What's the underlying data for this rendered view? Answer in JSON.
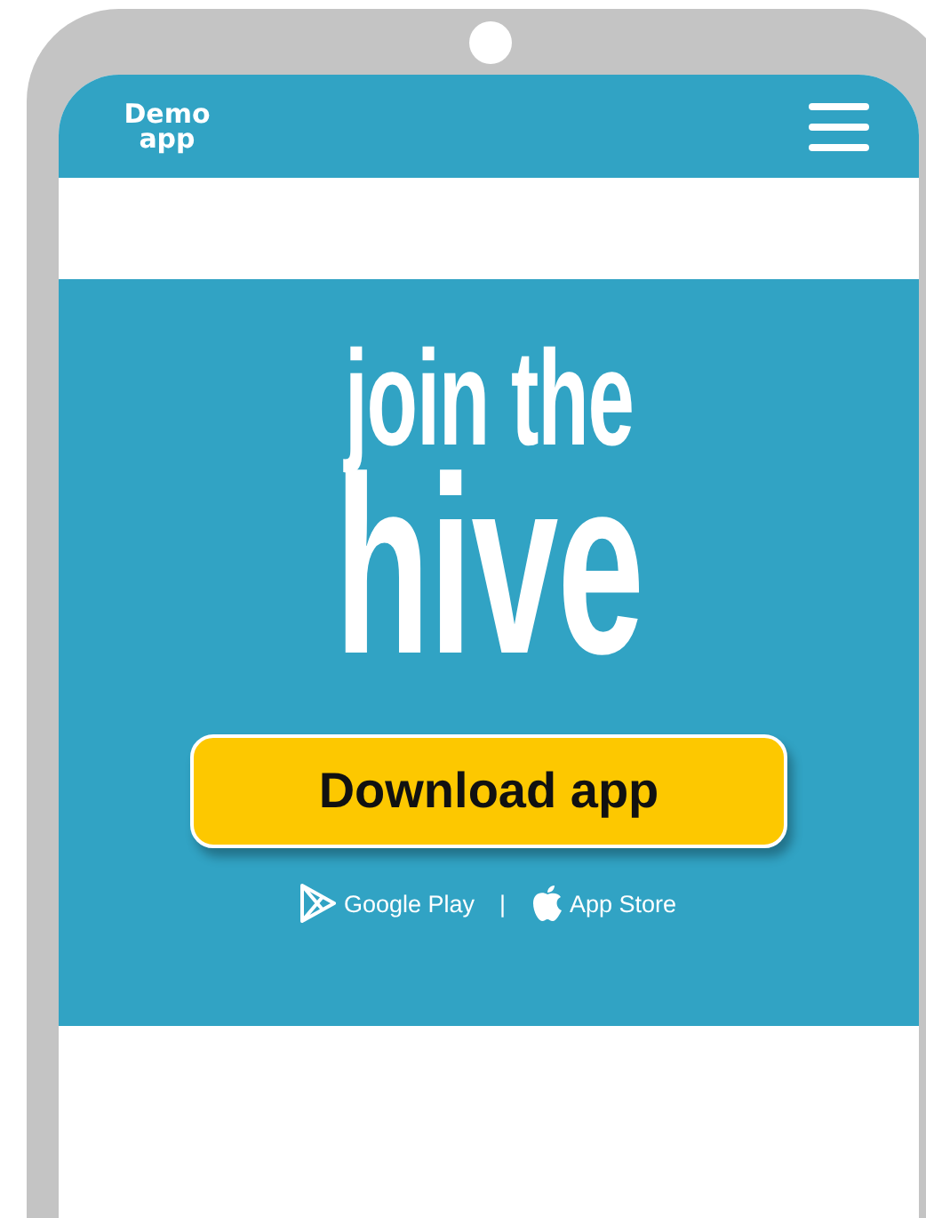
{
  "header": {
    "logo": "Demo app"
  },
  "hero": {
    "headline_lines": [
      "join the",
      "hive"
    ],
    "button": "Download app",
    "separator": "|",
    "store_links": [
      {
        "kind": "google-play",
        "label": "Google Play"
      },
      {
        "kind": "app-store",
        "label": "App Store"
      }
    ]
  }
}
